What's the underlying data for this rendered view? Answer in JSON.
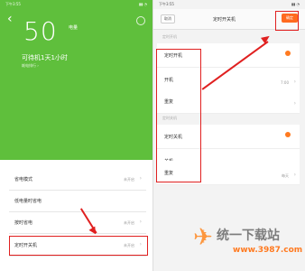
{
  "left": {
    "status_time": "下午3:55",
    "status_icons": "▮▮ ◔",
    "battery_percent": "50",
    "unit": "电量",
    "sub": "",
    "standby": "可待机1天1小时",
    "standby_hint": "耗电排行 ›",
    "rows": [
      {
        "label": "省电模式",
        "value": "未开启"
      },
      {
        "label": "低电量时省电",
        "value": ""
      },
      {
        "label": "按时省电",
        "value": "未开启"
      },
      {
        "label": "定时开关机",
        "value": "未开启"
      }
    ],
    "chevron": "›",
    "back_glyph": "‹"
  },
  "right": {
    "status_time": "下午3:55",
    "status_icons": "▮▮ ◔",
    "cancel": "取消",
    "title": "定时开关机",
    "save": "确定",
    "section_on": "定时开机",
    "section_off": "定时关机",
    "rows": [
      {
        "label": "定时开机",
        "value": ""
      },
      {
        "label": "开机",
        "value": "7:00"
      },
      {
        "label": "重复",
        "value": ""
      },
      {
        "label": "定时关机",
        "value": ""
      },
      {
        "label": "关机",
        "value": ""
      },
      {
        "label": "重复",
        "value": "每天"
      }
    ],
    "chevron": "›"
  },
  "watermark": {
    "logo": "✈",
    "text": "统一下载站",
    "url": "www.3987.com"
  },
  "colors": {
    "green": "#5fbf3c",
    "accent": "#ff6a1f",
    "annotation_red": "#e02020"
  }
}
